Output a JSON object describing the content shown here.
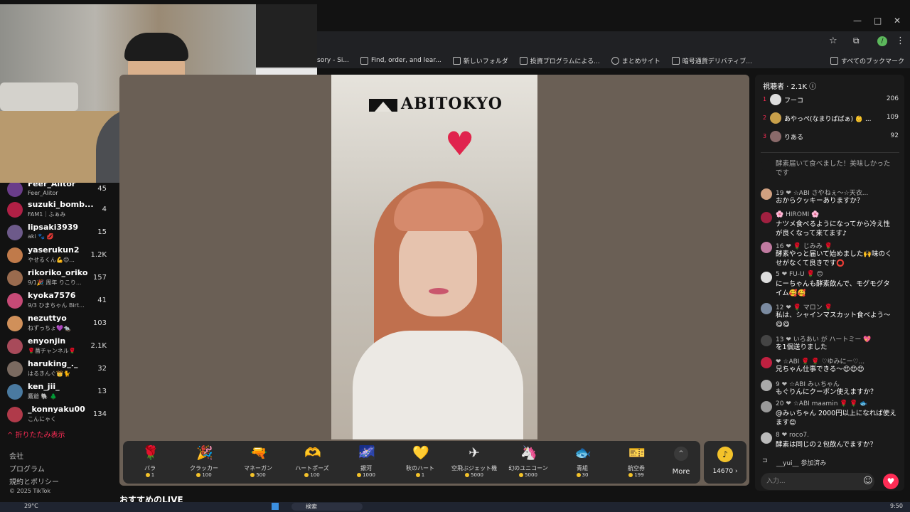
{
  "window": {
    "min": "—",
    "max": "□",
    "close": "✕"
  },
  "addressbar": {
    "star_icon": "☆",
    "ext_icon": "⧉",
    "profile": "/",
    "menu": "⋮"
  },
  "bookmarks": [
    {
      "label": "sory - Si..."
    },
    {
      "label": "Find, order, and lear..."
    },
    {
      "label": "新しいフォルダ"
    },
    {
      "label": "投資プログラムによる..."
    },
    {
      "label": "まとめサイト"
    },
    {
      "label": "暗号通貨デリバティブ..."
    }
  ],
  "bookmarks_all": "すべてのブックマーク",
  "sidebar": {
    "users": [
      {
        "name": "Feer_Alitor",
        "sub": "Feer_Alitor",
        "count": "45",
        "color": "#6a3d8a"
      },
      {
        "name": "suzuki_bomb...",
        "sub": "FAM1｜ふぁみ",
        "count": "4",
        "color": "#b02045"
      },
      {
        "name": "lipsaki3939",
        "sub": "aki 🐾 💋",
        "count": "15",
        "color": "#6d5a8a"
      },
      {
        "name": "yaserukun2",
        "sub": "やせるくん💪😊...",
        "count": "1.2K",
        "color": "#c07a4a"
      },
      {
        "name": "rikoriko_oriko",
        "sub": "9/1🎉 周年 りこり...",
        "count": "157",
        "color": "#9a6b4e"
      },
      {
        "name": "kyoka7576",
        "sub": "9/3 ひまちゃん Birt...",
        "count": "41",
        "color": "#c64a76"
      },
      {
        "name": "nezuttyo",
        "sub": "ねずっちょ💜🐀",
        "count": "103",
        "color": "#d0905a"
      },
      {
        "name": "enyonjin",
        "sub": "🌹薔チャンネル🌹",
        "count": "2.1K",
        "color": "#a84a5a"
      },
      {
        "name": "haruking_._",
        "sub": "はるきんぐ👑🐈",
        "count": "32",
        "color": "#7a6a60"
      },
      {
        "name": "ken_jii_",
        "sub": "鷹爺 🐘 🌲",
        "count": "13",
        "color": "#4a7aa0"
      },
      {
        "name": "_konnyaku00",
        "sub": "こんにゃく",
        "count": "134",
        "color": "#b03a4a"
      }
    ],
    "collapse": "^ 折りたたみ表示",
    "footer": [
      "会社",
      "プログラム",
      "規約とポリシー",
      "© 2025 TikTok"
    ]
  },
  "video": {
    "logo": "ABITOKYO",
    "heart": "♥"
  },
  "gifts": [
    {
      "name": "バラ",
      "price": "1",
      "icon": "🌹"
    },
    {
      "name": "クラッカー",
      "price": "100",
      "icon": "🎉"
    },
    {
      "name": "マネーガン",
      "price": "500",
      "icon": "🔫"
    },
    {
      "name": "ハートポーズ",
      "price": "100",
      "icon": "🫶"
    },
    {
      "name": "銀河",
      "price": "1000",
      "icon": "🌌"
    },
    {
      "name": "秋のハート",
      "price": "1",
      "icon": "💛"
    },
    {
      "name": "空飛ぶジェット機",
      "price": "5000",
      "icon": "✈"
    },
    {
      "name": "幻のユニコーン",
      "price": "5000",
      "icon": "🦄"
    },
    {
      "name": "青組",
      "price": "30",
      "icon": "🐟"
    },
    {
      "name": "航空券",
      "price": "199",
      "icon": "🎫"
    }
  ],
  "more_label": "More",
  "more_icon": "^",
  "coins": {
    "icon": "♪",
    "balance": "14670 ›"
  },
  "recommended": "おすすめのLIVE",
  "viewers": {
    "label": "視聴者 · 2.1K ⓘ"
  },
  "ranking": [
    {
      "rank": "1",
      "name": "フーコ",
      "score": "206",
      "color": "#dddddd"
    },
    {
      "rank": "2",
      "name": "あやっぺ(なまりばばぁ) 👶 ...",
      "score": "109",
      "color": "#c9a04a"
    },
    {
      "rank": "3",
      "name": "りある",
      "score": "92",
      "color": "#8a6a6a"
    }
  ],
  "chat": [
    {
      "head": "",
      "text": "酵素届いて食べました！美味しかったです",
      "color": "#1a1a1a"
    },
    {
      "head": "19 ❤ ☆ABI さやねぇ～☆天衣...",
      "text": "おからクッキーありますか？",
      "color": "#d0a080"
    },
    {
      "head": "🌸 HIROMI 🌸",
      "text": "ナツメ食べるようになってから冷え性が良くなって来てます♪",
      "color": "#a02040"
    },
    {
      "head": "16 ❤ 🌹 じみみ 🌹",
      "text": "酵素やっと届いて始めました🙌味のくせがなくて良きです⭕",
      "color": "#c07aa0"
    },
    {
      "head": "5 ❤ FU-U 🌹 😊",
      "text": "にーちゃんも酵素飲んで、モグモグタイム🥰🥰",
      "color": "#dddddd"
    },
    {
      "head": "12 ❤ 🌹 マロン 🌹",
      "text": "私は、シャインマスカット食べよう〜😋😋",
      "color": "#7a8aa0"
    },
    {
      "head": "13 ❤ いろあい が ハートミー 💖",
      "text": "を1個送りました",
      "color": "#444444"
    },
    {
      "head": "❤ ☆ABI 🌹 🌹 ♡ゆみにー♡...",
      "text": "兄ちゃん仕事できる〜😍😍😍",
      "color": "#c02040"
    },
    {
      "head": "9 ❤ ☆ABI みぃちゃん",
      "text": "もぐりんにクーポン使えますか？",
      "color": "#aaaaaa"
    },
    {
      "head": "20 ❤ ☆ABI maamin 🌹 🌹 🐟",
      "text": "@みぃちゃん 2000円以上になれば使えます😊",
      "color": "#999999"
    },
    {
      "head": "8 ❤ roco7.",
      "text": "酵素は同じの２包飲んでますか？",
      "color": "#bbbbbb"
    }
  ],
  "joined": "__yui__ 参加済み",
  "chat_input_placeholder": "入力...",
  "emoji_icon": "☺",
  "heart_icon": "♥",
  "taskbar": {
    "temp": "29°C",
    "search": "検索",
    "time": "9:50"
  }
}
